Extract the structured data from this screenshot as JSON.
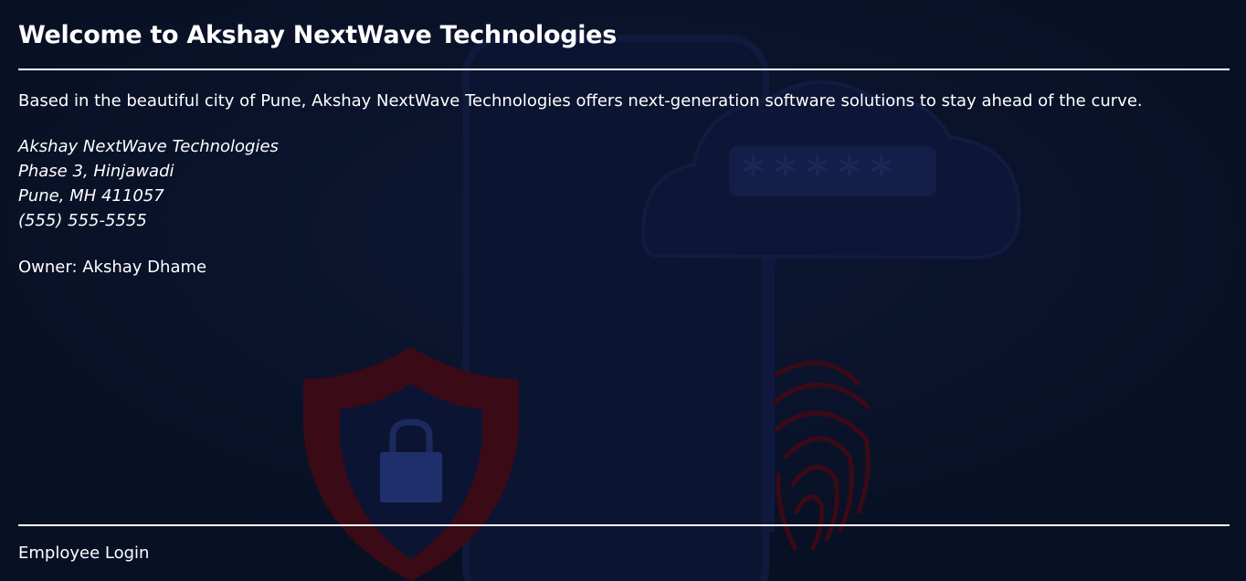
{
  "header": {
    "title": "Welcome to Akshay NextWave Technologies"
  },
  "main": {
    "intro": "Based in the beautiful city of Pune, Akshay NextWave Technologies offers next-generation software solutions to stay ahead of the curve.",
    "address": {
      "company": "Akshay NextWave Technologies",
      "street": "Phase 3, Hinjawadi",
      "city": "Pune, MH 411057",
      "phone": "(555) 555-5555"
    },
    "owner": "Owner: Akshay Dhame"
  },
  "footer": {
    "login_label": "Employee Login"
  },
  "background": {
    "password_mask": "*****",
    "icons": [
      "phone-outline-icon",
      "cloud-password-icon",
      "shield-lock-icon",
      "fingerprint-icon"
    ]
  },
  "colors": {
    "page_bg": "#0a1128",
    "text": "#ffffff",
    "shield_red": "#4a0d1a",
    "lock_blue": "#1f2f6b"
  }
}
